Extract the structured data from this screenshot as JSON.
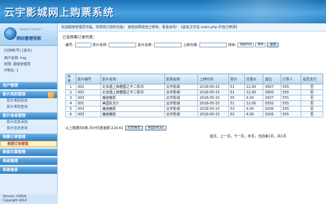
{
  "header": {
    "title": "云宇影城网上购票系统"
  },
  "sidebar": {
    "subtitle": "TRAVRLE TOURIST",
    "nav_title": "网站管理导航",
    "links": [
      "[切换账号]",
      "[退出]"
    ],
    "user": {
      "name_label": "用户名称:",
      "name_value": "hzg",
      "role_label": "权限:",
      "role_value": "超级管理员",
      "ip_label": "IP地址:",
      "ip_value": "1"
    },
    "groups": [
      {
        "title": "用户管理",
        "items": []
      },
      {
        "title": "影片类别管理",
        "items": [
          "影片类别添加",
          "影片类别查询"
        ]
      },
      {
        "title": "影片信息管理",
        "items": [
          "影片信息添加",
          "影片信息查询"
        ]
      },
      {
        "title": "购票订单管理",
        "items": [
          "购票订单管理"
        ]
      },
      {
        "title": "新闻文章管理",
        "items": []
      },
      {
        "title": "系统管理",
        "items": []
      },
      {
        "title": "系统信息",
        "items": []
      }
    ],
    "footer": {
      "version": "Version: V2018",
      "copyright": "Copyright 2014"
    }
  },
  "main": {
    "topbar": "欢迎超级管理员光临，非常高兴您的光临！ 其他说明请自己修改，看看会吗！【此处文字在 main.php 中自己修改】",
    "section": "已有购票订单列表：",
    "search": {
      "fields": [
        "编号:",
        "影片名称:",
        "影片名称:",
        "上映日期:"
      ],
      "sort_label": "排序:",
      "sort_value": "添加时间",
      "order_value": "降序",
      "button": "查询"
    },
    "table": {
      "headers": [
        "序号",
        "影片编号",
        "影片名称",
        "影院名称",
        "上映时间",
        "票价",
        "优惠价",
        "座位",
        "订票人",
        "是否支付"
      ],
      "rows": [
        [
          "1",
          "002",
          "北京遇上西雅图之不二情书",
          "云宇影城",
          "2018-05-15",
          "51",
          "12.00",
          "0907",
          "555",
          "否"
        ],
        [
          "2",
          "002",
          "北京遇上西雅图之不二情书",
          "云宇影城",
          "2018-05-15",
          "51",
          "12.00",
          "0905",
          "555",
          "否"
        ],
        [
          "3",
          "003",
          "魔宫魅影",
          "云宇影城",
          "2018-05-15",
          "55",
          "4.00",
          "0507",
          "555",
          "否"
        ],
        [
          "4",
          "001",
          "美国队长3",
          "云宇影城",
          "2018-05-15",
          "51",
          "12.00",
          "0302",
          "555",
          "否"
        ],
        [
          "5",
          "003",
          "魔宫魅影",
          "云宇影城",
          "2018-05-15",
          "53",
          "4.00",
          "0206",
          "555",
          "否"
        ],
        [
          "6",
          "003",
          "魔宫魅影",
          "云宇影城",
          "2018-05-15",
          "53",
          "4.00",
          "0205",
          "555",
          "否"
        ]
      ]
    },
    "summary": "以上数据共6条,共计优惠金额:218.41",
    "print_button": "打印本页",
    "export_button": "导出EXCEL",
    "pager": "首页，上一页，下一页，末页，当前第1页，共1页"
  }
}
